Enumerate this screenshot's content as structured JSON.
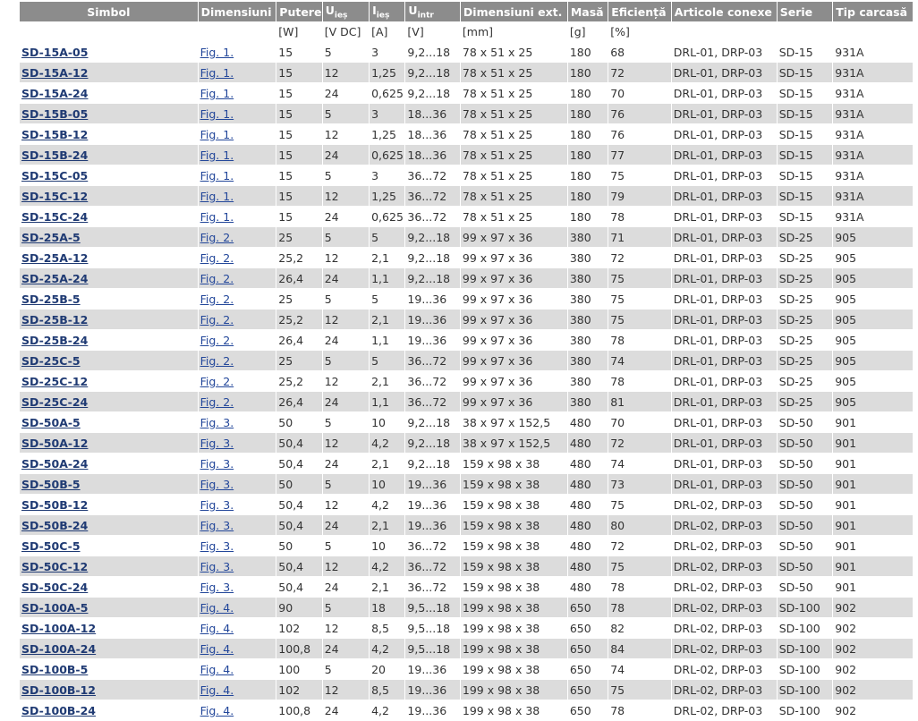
{
  "headers": [
    {
      "label": "Simbol",
      "sub": ""
    },
    {
      "label": "Dimensiuni",
      "sub": ""
    },
    {
      "label": "Putere",
      "sub": ""
    },
    {
      "label": "U",
      "sub": "ieș"
    },
    {
      "label": "I",
      "sub": "ieș"
    },
    {
      "label": "U",
      "sub": "intr"
    },
    {
      "label": "Dimensiuni ext.",
      "sub": ""
    },
    {
      "label": "Masă",
      "sub": ""
    },
    {
      "label": "Eficiență",
      "sub": ""
    },
    {
      "label": "Articole conexe",
      "sub": ""
    },
    {
      "label": "Serie",
      "sub": ""
    },
    {
      "label": "Tip carcasă",
      "sub": ""
    }
  ],
  "units": [
    "",
    "",
    "[W]",
    "[V DC]",
    "[A]",
    "[V]",
    "[mm]",
    "[g]",
    "[%]",
    "",
    "",
    ""
  ],
  "rows": [
    [
      "SD-15A-05",
      "Fig. 1.",
      "15",
      "5",
      "3",
      "9,2...18",
      "78 x 51 x 25",
      "180",
      "68",
      "DRL-01, DRP-03",
      "SD-15",
      "931A"
    ],
    [
      "SD-15A-12",
      "Fig. 1.",
      "15",
      "12",
      "1,25",
      "9,2...18",
      "78 x 51 x 25",
      "180",
      "72",
      "DRL-01, DRP-03",
      "SD-15",
      "931A"
    ],
    [
      "SD-15A-24",
      "Fig. 1.",
      "15",
      "24",
      "0,625",
      "9,2...18",
      "78 x 51 x 25",
      "180",
      "70",
      "DRL-01, DRP-03",
      "SD-15",
      "931A"
    ],
    [
      "SD-15B-05",
      "Fig. 1.",
      "15",
      "5",
      "3",
      "18...36",
      "78 x 51 x 25",
      "180",
      "76",
      "DRL-01, DRP-03",
      "SD-15",
      "931A"
    ],
    [
      "SD-15B-12",
      "Fig. 1.",
      "15",
      "12",
      "1,25",
      "18...36",
      "78 x 51 x 25",
      "180",
      "76",
      "DRL-01, DRP-03",
      "SD-15",
      "931A"
    ],
    [
      "SD-15B-24",
      "Fig. 1.",
      "15",
      "24",
      "0,625",
      "18...36",
      "78 x 51 x 25",
      "180",
      "77",
      "DRL-01, DRP-03",
      "SD-15",
      "931A"
    ],
    [
      "SD-15C-05",
      "Fig. 1.",
      "15",
      "5",
      "3",
      "36...72",
      "78 x 51 x 25",
      "180",
      "75",
      "DRL-01, DRP-03",
      "SD-15",
      "931A"
    ],
    [
      "SD-15C-12",
      "Fig. 1.",
      "15",
      "12",
      "1,25",
      "36...72",
      "78 x 51 x 25",
      "180",
      "79",
      "DRL-01, DRP-03",
      "SD-15",
      "931A"
    ],
    [
      "SD-15C-24",
      "Fig. 1.",
      "15",
      "24",
      "0,625",
      "36...72",
      "78 x 51 x 25",
      "180",
      "78",
      "DRL-01, DRP-03",
      "SD-15",
      "931A"
    ],
    [
      "SD-25A-5",
      "Fig. 2.",
      "25",
      "5",
      "5",
      "9,2...18",
      "99 x 97 x 36",
      "380",
      "71",
      "DRL-01, DRP-03",
      "SD-25",
      "905"
    ],
    [
      "SD-25A-12",
      "Fig. 2.",
      "25,2",
      "12",
      "2,1",
      "9,2...18",
      "99 x 97 x 36",
      "380",
      "72",
      "DRL-01, DRP-03",
      "SD-25",
      "905"
    ],
    [
      "SD-25A-24",
      "Fig. 2.",
      "26,4",
      "24",
      "1,1",
      "9,2...18",
      "99 x 97 x 36",
      "380",
      "75",
      "DRL-01, DRP-03",
      "SD-25",
      "905"
    ],
    [
      "SD-25B-5",
      "Fig. 2.",
      "25",
      "5",
      "5",
      "19...36",
      "99 x 97 x 36",
      "380",
      "75",
      "DRL-01, DRP-03",
      "SD-25",
      "905"
    ],
    [
      "SD-25B-12",
      "Fig. 2.",
      "25,2",
      "12",
      "2,1",
      "19...36",
      "99 x 97 x 36",
      "380",
      "75",
      "DRL-01, DRP-03",
      "SD-25",
      "905"
    ],
    [
      "SD-25B-24",
      "Fig. 2.",
      "26,4",
      "24",
      "1,1",
      "19...36",
      "99 x 97 x 36",
      "380",
      "78",
      "DRL-01, DRP-03",
      "SD-25",
      "905"
    ],
    [
      "SD-25C-5",
      "Fig. 2.",
      "25",
      "5",
      "5",
      "36...72",
      "99 x 97 x 36",
      "380",
      "74",
      "DRL-01, DRP-03",
      "SD-25",
      "905"
    ],
    [
      "SD-25C-12",
      "Fig. 2.",
      "25,2",
      "12",
      "2,1",
      "36...72",
      "99 x 97 x 36",
      "380",
      "78",
      "DRL-01, DRP-03",
      "SD-25",
      "905"
    ],
    [
      "SD-25C-24",
      "Fig. 2.",
      "26,4",
      "24",
      "1,1",
      "36...72",
      "99 x 97 x 36",
      "380",
      "81",
      "DRL-01, DRP-03",
      "SD-25",
      "905"
    ],
    [
      "SD-50A-5",
      "Fig. 3.",
      "50",
      "5",
      "10",
      "9,2...18",
      "38 x 97 x 152,5",
      "480",
      "70",
      "DRL-01, DRP-03",
      "SD-50",
      "901"
    ],
    [
      "SD-50A-12",
      "Fig. 3.",
      "50,4",
      "12",
      "4,2",
      "9,2...18",
      "38 x 97 x 152,5",
      "480",
      "72",
      "DRL-01, DRP-03",
      "SD-50",
      "901"
    ],
    [
      "SD-50A-24",
      "Fig. 3.",
      "50,4",
      "24",
      "2,1",
      "9,2...18",
      "159 x 98 x 38",
      "480",
      "74",
      "DRL-01, DRP-03",
      "SD-50",
      "901"
    ],
    [
      "SD-50B-5",
      "Fig. 3.",
      "50",
      "5",
      "10",
      "19...36",
      "159 x 98 x 38",
      "480",
      "73",
      "DRL-01, DRP-03",
      "SD-50",
      "901"
    ],
    [
      "SD-50B-12",
      "Fig. 3.",
      "50,4",
      "12",
      "4,2",
      "19...36",
      "159 x 98 x 38",
      "480",
      "75",
      "DRL-02, DRP-03",
      "SD-50",
      "901"
    ],
    [
      "SD-50B-24",
      "Fig. 3.",
      "50,4",
      "24",
      "2,1",
      "19...36",
      "159 x 98 x 38",
      "480",
      "80",
      "DRL-02, DRP-03",
      "SD-50",
      "901"
    ],
    [
      "SD-50C-5",
      "Fig. 3.",
      "50",
      "5",
      "10",
      "36...72",
      "159 x 98 x 38",
      "480",
      "72",
      "DRL-02, DRP-03",
      "SD-50",
      "901"
    ],
    [
      "SD-50C-12",
      "Fig. 3.",
      "50,4",
      "12",
      "4,2",
      "36...72",
      "159 x 98 x 38",
      "480",
      "75",
      "DRL-02, DRP-03",
      "SD-50",
      "901"
    ],
    [
      "SD-50C-24",
      "Fig. 3.",
      "50,4",
      "24",
      "2,1",
      "36...72",
      "159 x 98 x 38",
      "480",
      "78",
      "DRL-02, DRP-03",
      "SD-50",
      "901"
    ],
    [
      "SD-100A-5",
      "Fig. 4.",
      "90",
      "5",
      "18",
      "9,5...18",
      "199 x 98 x 38",
      "650",
      "78",
      "DRL-02, DRP-03",
      "SD-100",
      "902"
    ],
    [
      "SD-100A-12",
      "Fig. 4.",
      "102",
      "12",
      "8,5",
      "9,5...18",
      "199 x 98 x 38",
      "650",
      "82",
      "DRL-02, DRP-03",
      "SD-100",
      "902"
    ],
    [
      "SD-100A-24",
      "Fig. 4.",
      "100,8",
      "24",
      "4,2",
      "9,5...18",
      "199 x 98 x 38",
      "650",
      "84",
      "DRL-02, DRP-03",
      "SD-100",
      "902"
    ],
    [
      "SD-100B-5",
      "Fig. 4.",
      "100",
      "5",
      "20",
      "19...36",
      "199 x 98 x 38",
      "650",
      "74",
      "DRL-02, DRP-03",
      "SD-100",
      "902"
    ],
    [
      "SD-100B-12",
      "Fig. 4.",
      "102",
      "12",
      "8,5",
      "19...36",
      "199 x 98 x 38",
      "650",
      "75",
      "DRL-02, DRP-03",
      "SD-100",
      "902"
    ],
    [
      "SD-100B-24",
      "Fig. 4.",
      "100,8",
      "24",
      "4,2",
      "19...36",
      "199 x 98 x 38",
      "650",
      "78",
      "DRL-02, DRP-03",
      "SD-100",
      "902"
    ]
  ],
  "colors": {
    "header_bg": "#8c8c8c",
    "row_alt_bg": "#dcdcdc",
    "symbol_link": "#1f3a73",
    "figure_link": "#23479a"
  }
}
